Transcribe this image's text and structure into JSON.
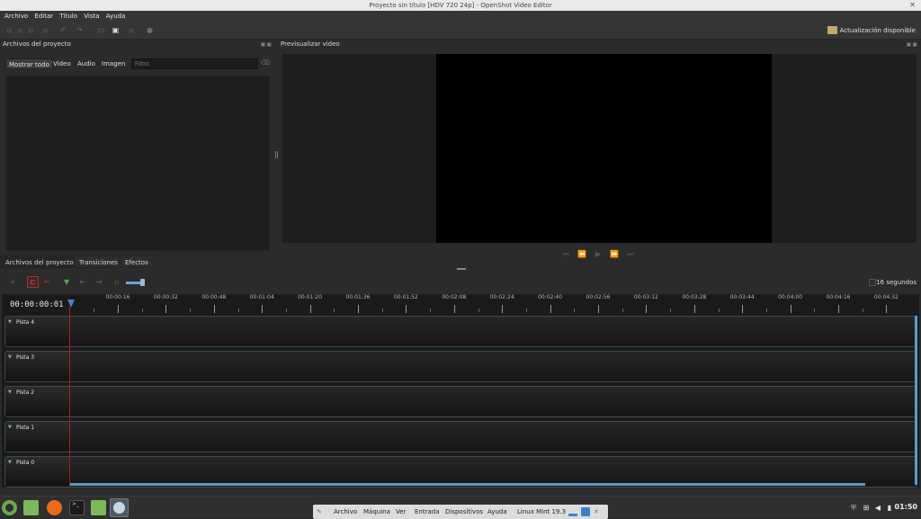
{
  "window": {
    "title": "Proyecto sin título [HDV 720 24p] - OpenShot Video Editor",
    "close": "✕"
  },
  "menu": [
    "Archivo",
    "Editar",
    "Título",
    "Vista",
    "Ayuda"
  ],
  "toolbar": {
    "update_label": "Actualización disponible"
  },
  "files_panel": {
    "title": "Archivos del proyecto",
    "filters": [
      "Mostrar todo",
      "Video",
      "Audio",
      "Imagen"
    ],
    "filter_placeholder": "Filtro",
    "tabs": [
      "Archivos del proyecto",
      "Transiciones",
      "Efectos"
    ]
  },
  "preview_panel": {
    "title": "Previsualizar video"
  },
  "timeline": {
    "timecode": "00:00:00:01",
    "scale_label": "16 segundos",
    "ruler_labels": [
      "00:00:16",
      "00:00:32",
      "00:00:48",
      "00:01:04",
      "00:01:20",
      "00:01:36",
      "00:01:52",
      "00:02:08",
      "00:02:24",
      "00:02:40",
      "00:02:56",
      "00:03:12",
      "00:03:28",
      "00:03:44",
      "00:04:00",
      "00:04:16",
      "00:04:32"
    ],
    "tracks": [
      "Pista 4",
      "Pista 3",
      "Pista 2",
      "Pista 1",
      "Pista 0"
    ]
  },
  "taskbar": {
    "vbox_menu": [
      "Archivo",
      "Máquina",
      "Ver",
      "Entrada",
      "Dispositivos",
      "Ayuda"
    ],
    "vbox_vm": "Linux Mint 19.3",
    "clock": "01:50"
  }
}
